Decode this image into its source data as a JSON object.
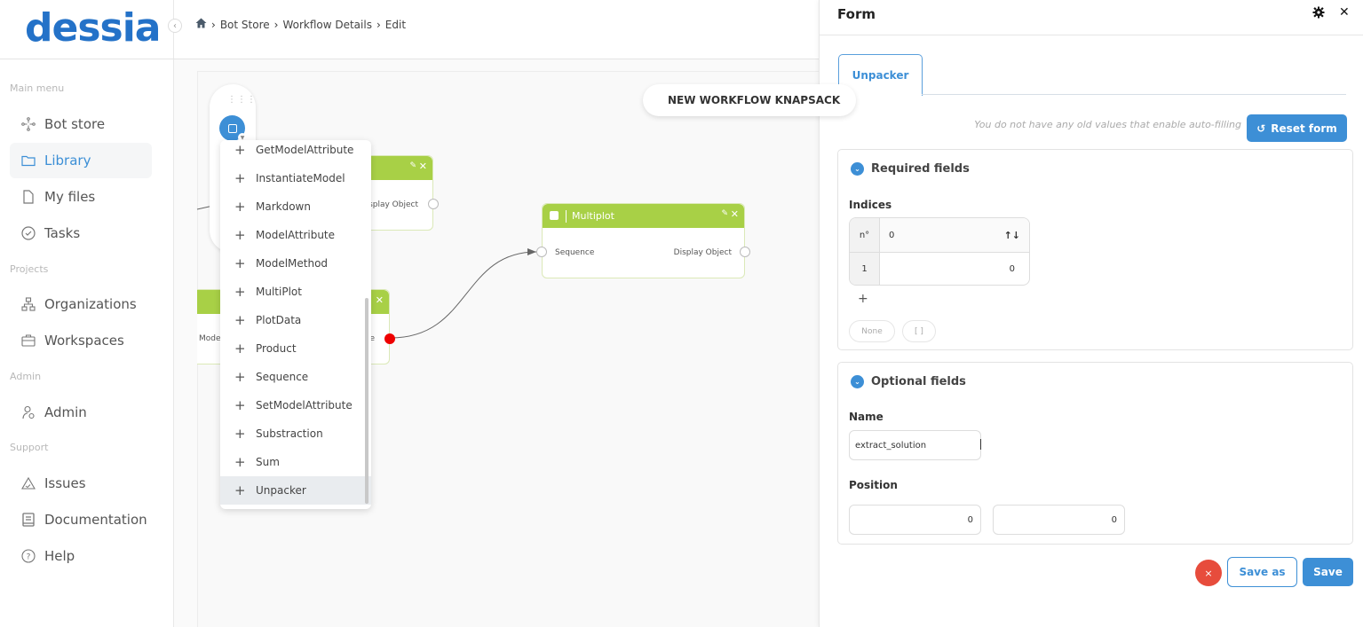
{
  "brand": {
    "logo_text": "dessia",
    "color": "#2472c8"
  },
  "sidebar": {
    "sections": {
      "main_menu": "Main menu",
      "projects": "Projects",
      "admin": "Admin",
      "support": "Support"
    },
    "items": [
      {
        "label": "Bot store",
        "icon": "bot-store-icon",
        "active": false
      },
      {
        "label": "Library",
        "icon": "folder-icon",
        "active": true
      },
      {
        "label": "My files",
        "icon": "file-icon",
        "active": false
      },
      {
        "label": "Tasks",
        "icon": "check-circle-icon",
        "active": false
      },
      {
        "label": "Organizations",
        "icon": "org-chart-icon",
        "active": false
      },
      {
        "label": "Workspaces",
        "icon": "briefcase-icon",
        "active": false
      },
      {
        "label": "Admin",
        "icon": "user-gear-icon",
        "active": false
      },
      {
        "label": "Issues",
        "icon": "warning-icon",
        "active": false
      },
      {
        "label": "Documentation",
        "icon": "book-icon",
        "active": false
      },
      {
        "label": "Help",
        "icon": "help-circle-icon",
        "active": false
      }
    ]
  },
  "breadcrumb": {
    "home_icon": "home-icon",
    "items": [
      "Bot Store",
      "Workflow Details",
      "Edit"
    ]
  },
  "canvas": {
    "workflow_title": "NEW WORKFLOW KNAPSACK",
    "nodes": [
      {
        "title": "",
        "output": "Display Object"
      },
      {
        "title": "",
        "input": "Mode",
        "output": "Sequence"
      },
      {
        "title": "Multiplot",
        "input": "Sequence",
        "output": "Display Object"
      }
    ],
    "block_menu": [
      "GetModelAttribute",
      "InstantiateModel",
      "Markdown",
      "ModelAttribute",
      "ModelMethod",
      "MultiPlot",
      "PlotData",
      "Product",
      "Sequence",
      "SetModelAttribute",
      "Substraction",
      "Sum",
      "Unpacker"
    ],
    "hovered_item": "Unpacker"
  },
  "form": {
    "title": "Form",
    "tab": "Unpacker",
    "autofill_message": "You do not have any old values that enable auto-filling",
    "reset_label": "Reset form",
    "required": {
      "title": "Required fields",
      "indices_label": "Indices",
      "table_header": {
        "index": "n°",
        "value": "0"
      },
      "rows": [
        {
          "index": "1",
          "value": "0"
        }
      ],
      "add_label": "+",
      "none_label": "None",
      "empty_list_label": "[ ]"
    },
    "optional": {
      "title": "Optional fields",
      "name_label": "Name",
      "name_value": "extract_solution",
      "position_label": "Position",
      "position_x": "0",
      "position_y": "0"
    },
    "cancel_label": "×",
    "save_as_label": "Save as",
    "save_label": "Save"
  }
}
